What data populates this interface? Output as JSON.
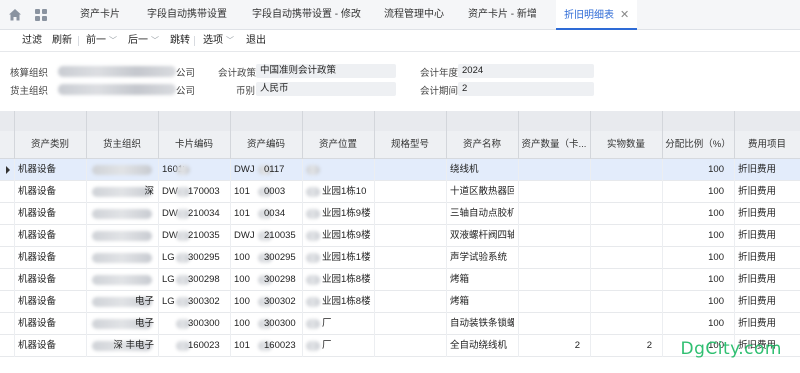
{
  "tabs": [
    {
      "label": "资产卡片"
    },
    {
      "label": "字段自动携带设置"
    },
    {
      "label": "字段自动携带设置 - 修改"
    },
    {
      "label": "流程管理中心"
    },
    {
      "label": "资产卡片 - 新增"
    },
    {
      "label": "折旧明细表",
      "active": true
    }
  ],
  "toolbar": {
    "filter": "过滤",
    "refresh": "刷新",
    "prev": "前一",
    "next": "后一",
    "jump": "跳转",
    "options": "选项",
    "exit": "退出"
  },
  "form": {
    "org_label": "核算组织",
    "org_suffix": "公司",
    "owner_label": "货主组织",
    "owner_suffix": "公司",
    "policy_label": "会计政策",
    "policy_value": "中国准则会计政策",
    "currency_label": "币别",
    "currency_value": "人民币",
    "year_label": "会计年度",
    "year_value": "2024",
    "period_label": "会计期间",
    "period_value": "2"
  },
  "table": {
    "columns": [
      "资产类别",
      "货主组织",
      "卡片编码",
      "资产编码",
      "资产位置",
      "规格型号",
      "资产名称",
      "资产数量（卡...",
      "实物数量",
      "分配比例（%）",
      "费用项目"
    ],
    "rows": [
      {
        "category": "机器设备",
        "owner": "",
        "card": "160117",
        "asset": "DWJ",
        "asset_tail": "0117",
        "location": "",
        "spec": "",
        "name": "绕线机",
        "qty_card": "",
        "qty_real": "",
        "ratio": "100",
        "expense": "折旧费用",
        "selected": true
      },
      {
        "category": "机器设备",
        "owner": "深",
        "card": "DW",
        "card_tail": "170003",
        "asset": "101",
        "asset_tail": "0003",
        "location": "业园1栋10",
        "spec": "",
        "name": "十道区散热器回流",
        "qty_card": "",
        "qty_real": "",
        "ratio": "100",
        "expense": "折旧费用"
      },
      {
        "category": "机器设备",
        "owner": "",
        "card": "DW",
        "card_tail": "210034",
        "asset": "101",
        "asset_tail": "0034",
        "location": "业园1栋9楼",
        "spec": "",
        "name": "三轴自动点胶机TX",
        "qty_card": "",
        "qty_real": "",
        "ratio": "100",
        "expense": "折旧费用"
      },
      {
        "category": "机器设备",
        "owner": "",
        "card": "DW",
        "card_tail": "210035",
        "asset": "DWJ",
        "asset_tail": "210035",
        "location": "业园1栋9楼",
        "spec": "",
        "name": "双液螺杆阀四轴点",
        "qty_card": "",
        "qty_real": "",
        "ratio": "100",
        "expense": "折旧费用"
      },
      {
        "category": "机器设备",
        "owner": "",
        "card": "LG",
        "card_tail": "300295",
        "asset": "100",
        "asset_tail": "300295",
        "location": "业园1栋1楼",
        "spec": "",
        "name": "声学试验系统",
        "qty_card": "",
        "qty_real": "",
        "ratio": "100",
        "expense": "折旧费用"
      },
      {
        "category": "机器设备",
        "owner": "",
        "card": "LG",
        "card_tail": "300298",
        "asset": "100",
        "asset_tail": "300298",
        "location": "业园1栋8楼",
        "spec": "",
        "name": "烤箱",
        "qty_card": "",
        "qty_real": "",
        "ratio": "100",
        "expense": "折旧费用"
      },
      {
        "category": "机器设备",
        "owner": "电子",
        "card": "LG",
        "card_tail": "300302",
        "asset": "100",
        "asset_tail": "300302",
        "location": "业园1栋8楼",
        "spec": "",
        "name": "烤箱",
        "qty_card": "",
        "qty_real": "",
        "ratio": "100",
        "expense": "折旧费用"
      },
      {
        "category": "机器设备",
        "owner": "电子",
        "card": "",
        "card_tail": "300300",
        "asset": "100",
        "asset_tail": "300300",
        "location": "厂",
        "spec": "",
        "name": "自动装铁条锁螺丝",
        "qty_card": "",
        "qty_real": "",
        "ratio": "100",
        "expense": "折旧费用"
      },
      {
        "category": "机器设备",
        "owner": "深 丰电子",
        "card": "",
        "card_tail": "160023",
        "asset": "101",
        "asset_tail": "160023",
        "location": "厂",
        "spec": "",
        "name": "全自动绕线机",
        "qty_card": "2",
        "qty_real": "2",
        "ratio": "100",
        "expense": "折旧费用"
      }
    ]
  },
  "watermark": "DgCity.com",
  "colors": {
    "accent": "#2e6bd6",
    "selected_row": "#e3ecfb",
    "watermark": "#2fbf71"
  }
}
